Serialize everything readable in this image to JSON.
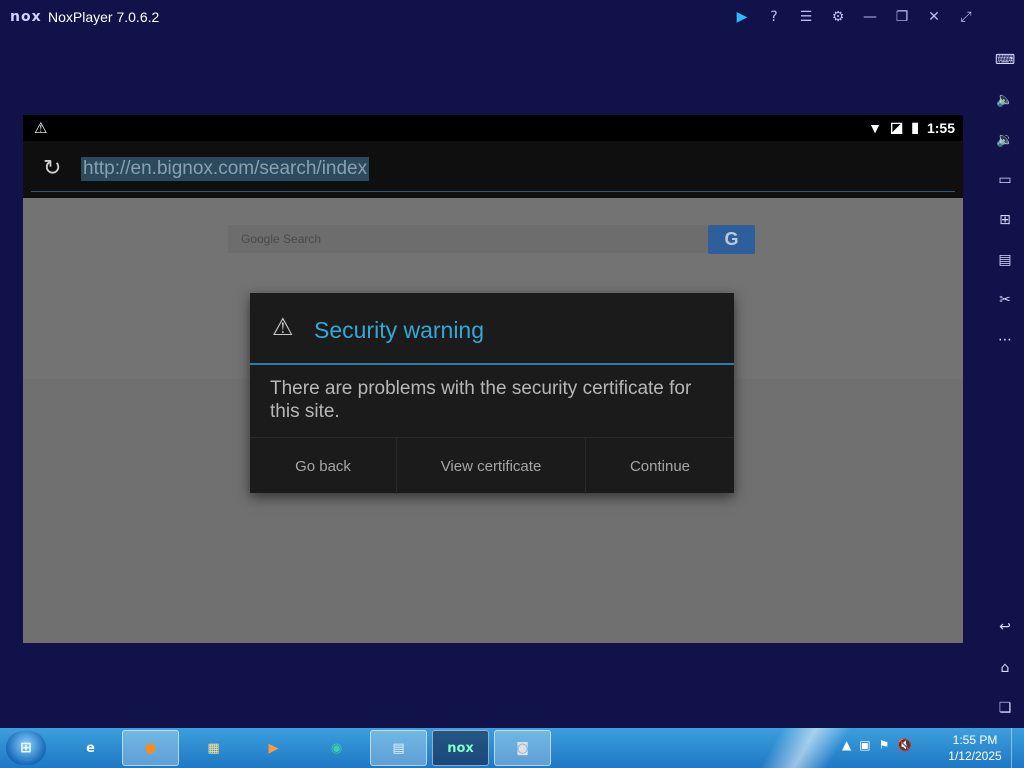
{
  "window": {
    "logo": "nox",
    "title": "NoxPlayer 7.0.6.2",
    "controls": [
      "play-icon",
      "help-icon",
      "menu-icon",
      "settings-icon",
      "minimize-icon",
      "restore-icon",
      "close-icon",
      "expand-icon"
    ]
  },
  "sidebar": {
    "top": [
      "keyboard-icon",
      "volume-up-icon",
      "volume-down-icon",
      "screen-icon",
      "apk-install-icon",
      "multi-instance-icon",
      "screenshot-cut-icon",
      "more-icon"
    ],
    "bottom": [
      "back-icon",
      "home-icon",
      "recent-apps-icon"
    ]
  },
  "android": {
    "status": {
      "time": "1:55"
    },
    "browser": {
      "url": "http://en.bignox.com/search/index"
    },
    "search": {
      "placeholder": "Google Search",
      "button": "G"
    }
  },
  "dialog": {
    "title": "Security warning",
    "message": "There are problems with the security certificate for this site.",
    "buttons": [
      "Go back",
      "View certificate",
      "Continue"
    ]
  },
  "taskbar": {
    "apps": [
      "internet-explorer",
      "firefox",
      "media-player",
      "file-explorer",
      "app-green",
      "control-panel",
      "noxplayer",
      "disk-tool"
    ],
    "clock": {
      "time": "1:55 PM",
      "date": "1/12/2025"
    }
  },
  "colors": {
    "desktop_bg": "#11124a",
    "dialog_accent": "#33a8d6",
    "taskbar": "#1f78c4"
  }
}
